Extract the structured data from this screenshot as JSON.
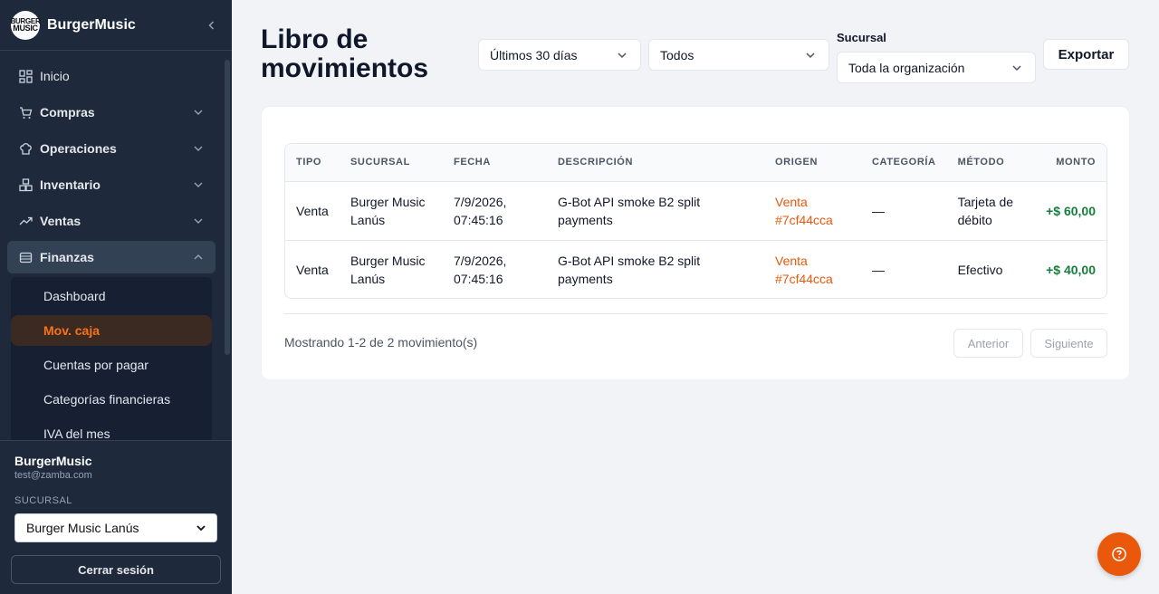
{
  "sidebar": {
    "brand": "BurgerMusic",
    "logo_text": [
      "BURGER",
      "MUSIC"
    ],
    "nav": [
      {
        "label": "Inicio",
        "icon": "grid-icon"
      },
      {
        "label": "Compras",
        "icon": "cart-icon"
      },
      {
        "label": "Operaciones",
        "icon": "chef-hat-icon"
      },
      {
        "label": "Inventario",
        "icon": "boxes-icon"
      },
      {
        "label": "Ventas",
        "icon": "trend-icon"
      },
      {
        "label": "Finanzas",
        "icon": "wallet-icon"
      }
    ],
    "finanzas_sub": [
      "Dashboard",
      "Mov. caja",
      "Cuentas por pagar",
      "Categorías financieras",
      "IVA del mes"
    ],
    "user_name": "BurgerMusic",
    "user_email": "test@zamba.com",
    "branch_label": "SUCURSAL",
    "branch_value": "Burger Music Lanús",
    "logout": "Cerrar sesión"
  },
  "header": {
    "title": "Libro de movimientos",
    "filter_period": "Últimos 30 días",
    "filter_type": "Todos",
    "branch_label": "Sucursal",
    "filter_branch": "Toda la organización",
    "export": "Exportar"
  },
  "table": {
    "columns": [
      "TIPO",
      "SUCURSAL",
      "FECHA",
      "DESCRIPCIÓN",
      "ORIGEN",
      "CATEGORÍA",
      "MÉTODO",
      "MONTO"
    ],
    "rows": [
      {
        "tipo": "Venta",
        "sucursal": "Burger Music Lanús",
        "fecha": "7/9/2026, 07:45:16",
        "descripcion": "G-Bot API smoke B2 split payments",
        "origen": "Venta #7cf44cca",
        "categoria": "—",
        "metodo": "Tarjeta de débito",
        "monto": "+$ 60,00"
      },
      {
        "tipo": "Venta",
        "sucursal": "Burger Music Lanús",
        "fecha": "7/9/2026, 07:45:16",
        "descripcion": "G-Bot API smoke B2 split payments",
        "origen": "Venta #7cf44cca",
        "categoria": "—",
        "metodo": "Efectivo",
        "monto": "+$ 40,00"
      }
    ]
  },
  "pagination": {
    "summary": "Mostrando 1-2 de 2 movimiento(s)",
    "prev": "Anterior",
    "next": "Siguiente"
  },
  "colors": {
    "accent": "#ea580c",
    "positive": "#15803d",
    "sidebar_bg": "#1e293b"
  }
}
